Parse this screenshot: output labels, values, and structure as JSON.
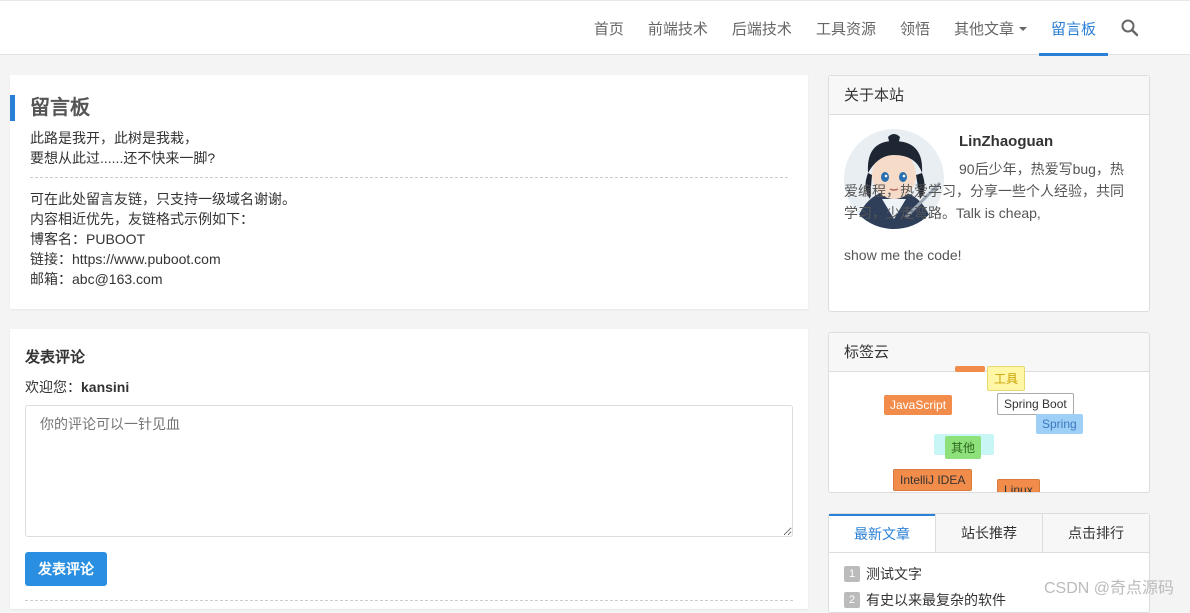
{
  "nav": {
    "items": [
      {
        "label": "首页"
      },
      {
        "label": "前端技术"
      },
      {
        "label": "后端技术"
      },
      {
        "label": "工具资源"
      },
      {
        "label": "领悟"
      },
      {
        "label": "其他文章"
      },
      {
        "label": "留言板"
      }
    ],
    "active_index": 6,
    "accent": "#2a7fd6"
  },
  "intro": {
    "title": "留言板",
    "lines_top": [
      "此路是我开，此树是我栽，",
      "要想从此过......还不快来一脚?"
    ],
    "lines_bottom": [
      "可在此处留言友链，只支持一级域名谢谢。",
      "内容相近优先，友链格式示例如下：",
      "博客名：PUBOOT",
      "链接：https://www.puboot.com",
      "邮箱：abc@163.com"
    ]
  },
  "comment": {
    "title": "发表评论",
    "welcome_prefix": "欢迎您：",
    "username": "kansini",
    "placeholder": "你的评论可以一针见血",
    "submit_label": "发表评论"
  },
  "about": {
    "heading": "关于本站",
    "author": "LinZhaoguan",
    "text_first": "90后少年，热爱写bug，热爱编程，热爱学习，分享一些个人经验，共同学习，少走弯路。Talk is cheap,",
    "text_last": "show me the code!"
  },
  "tags": {
    "heading": "标签云",
    "items": [
      {
        "label": "工具",
        "bg": "#fff6a6",
        "fg": "#c8a200"
      },
      {
        "label": "JavaScript",
        "bg": "#f28c4a",
        "fg": "#ffffff"
      },
      {
        "label": "Spring Boot",
        "bg": "#ffffff",
        "fg": "#333333"
      },
      {
        "label": "Spring",
        "bg": "#9ed0f7",
        "fg": "#3a78c0"
      },
      {
        "label": "其他",
        "bg": "#8ee07a",
        "fg": "#2f6a22"
      },
      {
        "label": "IntelliJ IDEA",
        "bg": "#f28c4a",
        "fg": "#333333"
      },
      {
        "label": "Linux",
        "bg": "#f28c4a",
        "fg": "#333333"
      }
    ]
  },
  "articles": {
    "tabs": [
      {
        "label": "最新文章"
      },
      {
        "label": "站长推荐"
      },
      {
        "label": "点击排行"
      }
    ],
    "active_tab": 0,
    "list": [
      {
        "num": "1",
        "title": "测试文字"
      },
      {
        "num": "2",
        "title": "有史以来最复杂的软件"
      }
    ]
  },
  "watermark": "CSDN @奇点源码"
}
